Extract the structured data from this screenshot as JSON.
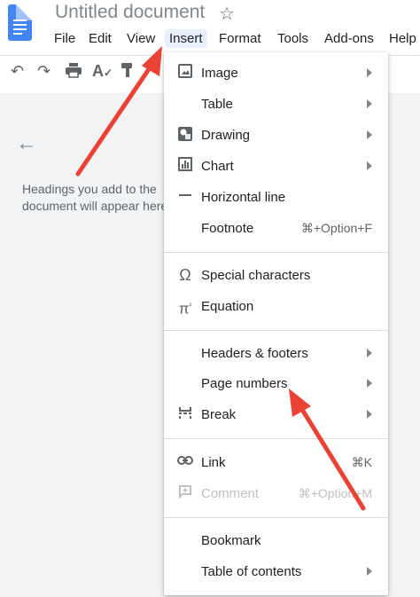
{
  "header": {
    "doc_title": "Untitled document",
    "menus": [
      "File",
      "Edit",
      "View",
      "Insert",
      "Format",
      "Tools",
      "Add-ons",
      "Help"
    ]
  },
  "toolbar": {
    "icons": [
      "undo-icon",
      "redo-icon",
      "print-icon",
      "spellcheck-icon",
      "paint-format-icon"
    ]
  },
  "outline": {
    "placeholder": "Headings you add to the document will appear here."
  },
  "insert_menu": {
    "items": [
      {
        "label": "Image",
        "icon": "image-icon",
        "submenu": true
      },
      {
        "label": "Table",
        "icon": "",
        "submenu": true
      },
      {
        "label": "Drawing",
        "icon": "drawing-icon",
        "submenu": true
      },
      {
        "label": "Chart",
        "icon": "chart-icon",
        "submenu": true
      },
      {
        "label": "Horizontal line",
        "icon": "horizontal-line-icon",
        "submenu": false
      },
      {
        "label": "Footnote",
        "icon": "",
        "shortcut": "⌘+Option+F",
        "submenu": false
      },
      {
        "label": "Special characters",
        "icon": "omega-icon",
        "submenu": false
      },
      {
        "label": "Equation",
        "icon": "pi-icon",
        "submenu": false
      },
      {
        "label": "Headers & footers",
        "icon": "",
        "submenu": true
      },
      {
        "label": "Page numbers",
        "icon": "",
        "submenu": true
      },
      {
        "label": "Break",
        "icon": "break-icon",
        "submenu": true
      },
      {
        "label": "Link",
        "icon": "link-icon",
        "shortcut": "⌘K",
        "submenu": false
      },
      {
        "label": "Comment",
        "icon": "comment-icon",
        "shortcut": "⌘+Option+M",
        "submenu": false,
        "disabled": true
      },
      {
        "label": "Bookmark",
        "icon": "",
        "submenu": false
      },
      {
        "label": "Table of contents",
        "icon": "",
        "submenu": true
      }
    ]
  },
  "colors": {
    "accent": "#4285f4",
    "arrow": "#ea4335",
    "active_menu_bg": "#e8f0fe"
  }
}
